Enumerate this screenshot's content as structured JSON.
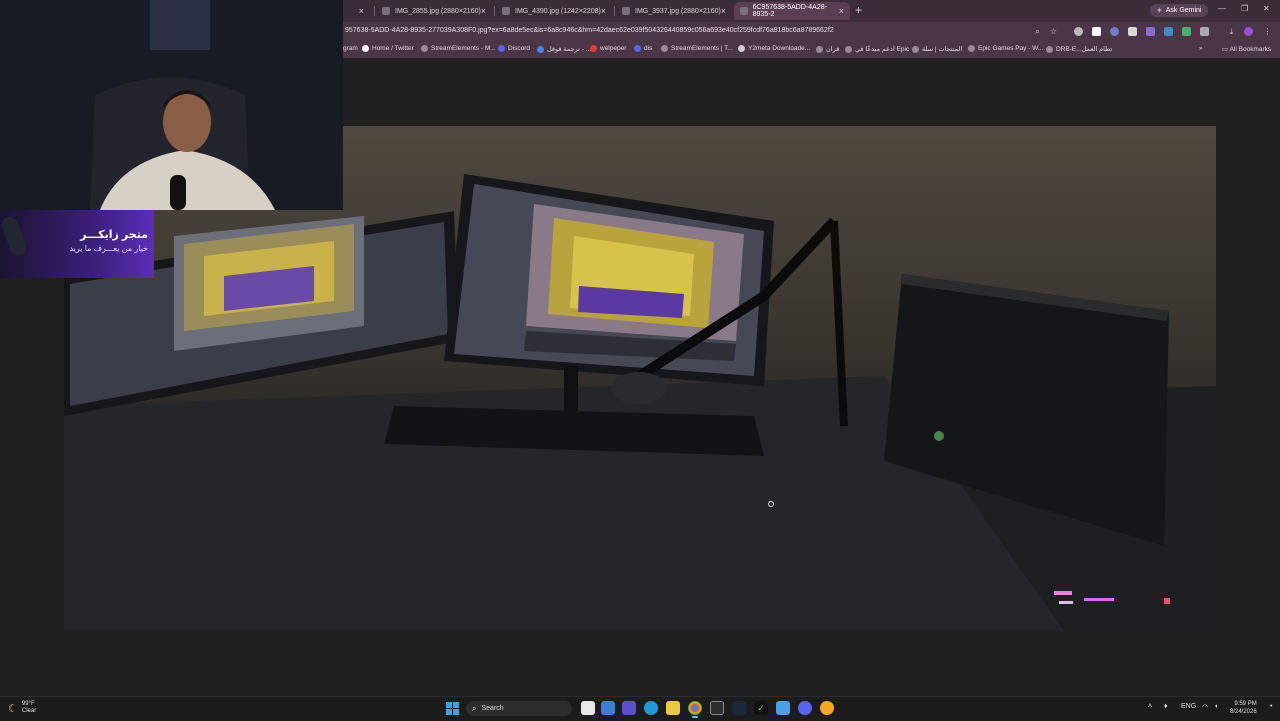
{
  "tabs": [
    {
      "label": ")",
      "active": false
    },
    {
      "label": "IMG_2855.jpg (2880×2160)",
      "active": false
    },
    {
      "label": "IMG_4390.jpg (1242×2208)",
      "active": false
    },
    {
      "label": "IMG_3937.jpg (2880×2160)",
      "active": false
    },
    {
      "label": "6C957638-5ADD-4A28-8935-2",
      "active": true
    }
  ],
  "browser": {
    "gemini_label": "Ask Gemini",
    "url": "957638-5ADD-4A28-8935-277039A308F0.jpg?ex=6a8de5ec&is=6a8c946c&hm=42daec62e039f504326440859c056a693e40cf259fcdf76a818bc6a8789662f2",
    "all_bookmarks": "All Bookmarks"
  },
  "bookmarks": [
    "gram",
    "Home / Twitter",
    "StreamElements - M...",
    "Discord",
    "ترجمة قوقل - ...",
    "welpeper",
    "dis",
    "StreamElements | T...",
    "Y2meta Downloade...",
    "قران",
    "ادعم مبدعًا في Epic",
    "المنتجات | سلة",
    "Epic Games Pay - W...",
    "DRB-E...تطام العمل"
  ],
  "promo": {
    "title": "متجر زايكـــر",
    "subtitle": "خيار من يعـــرف ما يريد"
  },
  "taskbar": {
    "temp": "99°F",
    "condition": "Clear",
    "search": "Search",
    "lang": "ENG",
    "time": "9:59 PM",
    "date": "8/24/2026"
  },
  "colors": {
    "tabstrip": "#3b2d38",
    "toolbar": "#4a3645",
    "active_tab": "#5a3f54",
    "viewer_bg": "#202020",
    "taskbar": "#1c1c1c"
  }
}
